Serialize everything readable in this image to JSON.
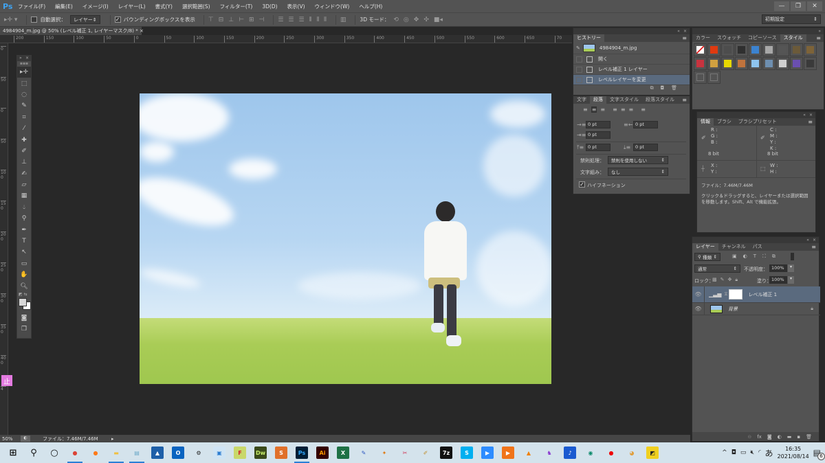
{
  "app": {
    "logo": "Ps",
    "menus": [
      "ファイル(F)",
      "編集(E)",
      "イメージ(I)",
      "レイヤー(L)",
      "書式(Y)",
      "選択範囲(S)",
      "フィルター(T)",
      "3D(D)",
      "表示(V)",
      "ウィンドウ(W)",
      "ヘルプ(H)"
    ],
    "window_controls": {
      "minimize": "—",
      "restore": "❐",
      "close": "✕"
    }
  },
  "options_bar": {
    "tool_icon": "move-tool",
    "auto_select_label": "自動選択：",
    "auto_select_checked": false,
    "auto_select_target": "レイヤー",
    "bounding_box_label": "バウンディングボックスを表示",
    "bounding_box_checked": true,
    "mode_3d_label": "3D モード：",
    "workspace": "初期設定"
  },
  "document": {
    "tab_title": "4984904_m.jpg @ 50% (レベル補正 1, レイヤーマスク/8) *",
    "tab_close": "×",
    "zoom": "50%",
    "status_file": "ファイル：7.46M/7.46M",
    "h_ruler_labels": [
      "200",
      "150",
      "100",
      "50",
      "0",
      "50",
      "100",
      "150",
      "200",
      "250",
      "300",
      "350",
      "400",
      "450",
      "500",
      "550",
      "600",
      "650",
      "70"
    ],
    "v_ruler_labels": [
      "0",
      "50",
      "0",
      "50",
      "100",
      "150",
      "200",
      "250",
      "300",
      "350",
      "400",
      "4"
    ]
  },
  "toolbox": {
    "tools": [
      "move",
      "marquee",
      "lasso",
      "quick-select",
      "crop",
      "eyedropper",
      "healing",
      "brush",
      "stamp",
      "history-brush",
      "eraser",
      "gradient",
      "blur",
      "dodge",
      "pen",
      "type",
      "path-select",
      "shape",
      "hand",
      "zoom"
    ],
    "foreground_color": "#d8d8d8",
    "background_color": "#ffffff"
  },
  "badge": {
    "label": "止"
  },
  "history_panel": {
    "tab": "ヒストリー",
    "snapshot": "4984904_m.jpg",
    "states": [
      {
        "label": "開く",
        "selected": false
      },
      {
        "label": "レベル補正 1 レイヤー",
        "selected": false
      },
      {
        "label": "レベルレイヤーを変更",
        "selected": true
      }
    ]
  },
  "paragraph_panel": {
    "tabs": [
      "文字",
      "段落",
      "文字スタイル",
      "段落スタイル"
    ],
    "active_tab": "段落",
    "indent_left": "0 pt",
    "indent_right": "0 pt",
    "indent_first": "0 pt",
    "space_before": "0 pt",
    "space_after": "0 pt",
    "kinsoku_label": "禁則処理：",
    "kinsoku_value": "禁則を使用しない",
    "mojikumi_label": "文字組み：",
    "mojikumi_value": "なし",
    "hyphenation_label": "ハイフネーション",
    "hyphenation_checked": true
  },
  "styles_panel": {
    "tabs": [
      "カラー",
      "スウォッチ",
      "コピーソース",
      "スタイル"
    ],
    "active_tab": "スタイル",
    "swatches": [
      "#ffffff",
      "#e03a10",
      "#4d4d4d",
      "#2f2f2f",
      "#3c83d0",
      "#a8a8a8",
      "#555555",
      "#6b5a3a",
      "#7d6338",
      "#c8333f",
      "#d0a040",
      "#e6d800",
      "#c0733d",
      "#8ec4ee",
      "#6e8fb0",
      "#cfcfcf",
      "#6a4fb0",
      "#3a3a3a",
      "#4a4a4a",
      "#4a4a4a"
    ]
  },
  "info_panel": {
    "tabs": [
      "情報",
      "ブラシ",
      "ブラシプリセット"
    ],
    "active_tab": "情報",
    "rgb": [
      "R :",
      "G :",
      "B :"
    ],
    "cmyk": [
      "C :",
      "M :",
      "Y :",
      "K :"
    ],
    "bit_left": "8 bit",
    "bit_right": "8 bit",
    "xy": [
      "X :",
      "Y :"
    ],
    "wh": [
      "W :",
      "H :"
    ],
    "file": "ファイル：7.46M/7.46M",
    "hint": "クリック＆ドラッグすると、レイヤーまたは選択範囲を移動します。Shift、Alt で機能拡張。"
  },
  "layers_panel": {
    "tabs": [
      "レイヤー",
      "チャンネル",
      "パス"
    ],
    "active_tab": "レイヤー",
    "filter_kind": "種類",
    "blend_mode": "通常",
    "opacity_label": "不透明度：",
    "opacity": "100%",
    "lock_label": "ロック：",
    "fill_label": "塗り：",
    "fill": "100%",
    "layers": [
      {
        "name": "レベル補正 1",
        "selected": true,
        "type": "adjustment"
      },
      {
        "name": "背景",
        "selected": false,
        "type": "background",
        "locked": true
      }
    ]
  },
  "taskbar": {
    "apps": [
      {
        "name": "windows-start",
        "glyph": "⊞",
        "color": "#111",
        "bg": "transparent"
      },
      {
        "name": "search",
        "glyph": "⚲",
        "color": "#111",
        "bg": "transparent"
      },
      {
        "name": "cortana",
        "glyph": "○",
        "color": "#111",
        "bg": "transparent"
      },
      {
        "name": "chrome",
        "glyph": "●",
        "color": "#db4437",
        "bg": "transparent",
        "open": true
      },
      {
        "name": "firefox",
        "glyph": "●",
        "color": "#ff7a18",
        "bg": "transparent"
      },
      {
        "name": "file-explorer",
        "glyph": "▬",
        "color": "#f0c040",
        "bg": "transparent",
        "open": true
      },
      {
        "name": "notepad",
        "glyph": "▤",
        "color": "#6aa8c8",
        "bg": "transparent",
        "open": true
      },
      {
        "name": "photos",
        "glyph": "▲",
        "color": "#fff",
        "bg": "#1d5fa8"
      },
      {
        "name": "outlook",
        "glyph": "O",
        "color": "#fff",
        "bg": "#0a64c0"
      },
      {
        "name": "settings",
        "glyph": "⚙",
        "color": "#222",
        "bg": "transparent"
      },
      {
        "name": "contacts",
        "glyph": "▣",
        "color": "#2a7bd0",
        "bg": "#cfe4f4"
      },
      {
        "name": "ftp",
        "glyph": "F",
        "color": "#d0202a",
        "bg": "#c9d86a"
      },
      {
        "name": "dreamweaver",
        "glyph": "Dw",
        "color": "#c9f06a",
        "bg": "#3a4a1a"
      },
      {
        "name": "sublime",
        "glyph": "S",
        "color": "#fff",
        "bg": "#e0702a"
      },
      {
        "name": "photoshop",
        "glyph": "Ps",
        "color": "#31a8ff",
        "bg": "#001e36",
        "open": true
      },
      {
        "name": "illustrator",
        "glyph": "Ai",
        "color": "#ff9a00",
        "bg": "#330000"
      },
      {
        "name": "excel",
        "glyph": "X",
        "color": "#fff",
        "bg": "#1e7145"
      },
      {
        "name": "pen-tool-app",
        "glyph": "✎",
        "color": "#2a55c0",
        "bg": "transparent"
      },
      {
        "name": "butterfly",
        "glyph": "✦",
        "color": "#e07a10",
        "bg": "transparent"
      },
      {
        "name": "snipping",
        "glyph": "✂",
        "color": "#d03a5a",
        "bg": "transparent"
      },
      {
        "name": "paint",
        "glyph": "✐",
        "color": "#c09030",
        "bg": "transparent"
      },
      {
        "name": "7zip",
        "glyph": "7z",
        "color": "#fff",
        "bg": "#111"
      },
      {
        "name": "skype",
        "glyph": "S",
        "color": "#fff",
        "bg": "#00aff0"
      },
      {
        "name": "zoom",
        "glyph": "▶",
        "color": "#fff",
        "bg": "#2d8cff"
      },
      {
        "name": "media-player",
        "glyph": "▶",
        "color": "#fff",
        "bg": "#f0741a"
      },
      {
        "name": "vlc",
        "glyph": "▲",
        "color": "#f08000",
        "bg": "transparent"
      },
      {
        "name": "purple-app",
        "glyph": "♞",
        "color": "#8a3ad0",
        "bg": "transparent"
      },
      {
        "name": "music",
        "glyph": "♪",
        "color": "#fff",
        "bg": "#1a5ad0"
      },
      {
        "name": "green-app",
        "glyph": "◉",
        "color": "#0a8a6a",
        "bg": "transparent"
      },
      {
        "name": "recorder",
        "glyph": "●",
        "color": "#e00",
        "bg": "transparent"
      },
      {
        "name": "fox-app",
        "glyph": "◕",
        "color": "#e0a040",
        "bg": "transparent"
      },
      {
        "name": "sticky-notes",
        "glyph": "◩",
        "color": "#222",
        "bg": "#f0d020"
      }
    ],
    "tray": {
      "chevron": "^",
      "ime": "あ",
      "time": "16:35",
      "date": "2021/08/14",
      "notifications": "6"
    }
  }
}
